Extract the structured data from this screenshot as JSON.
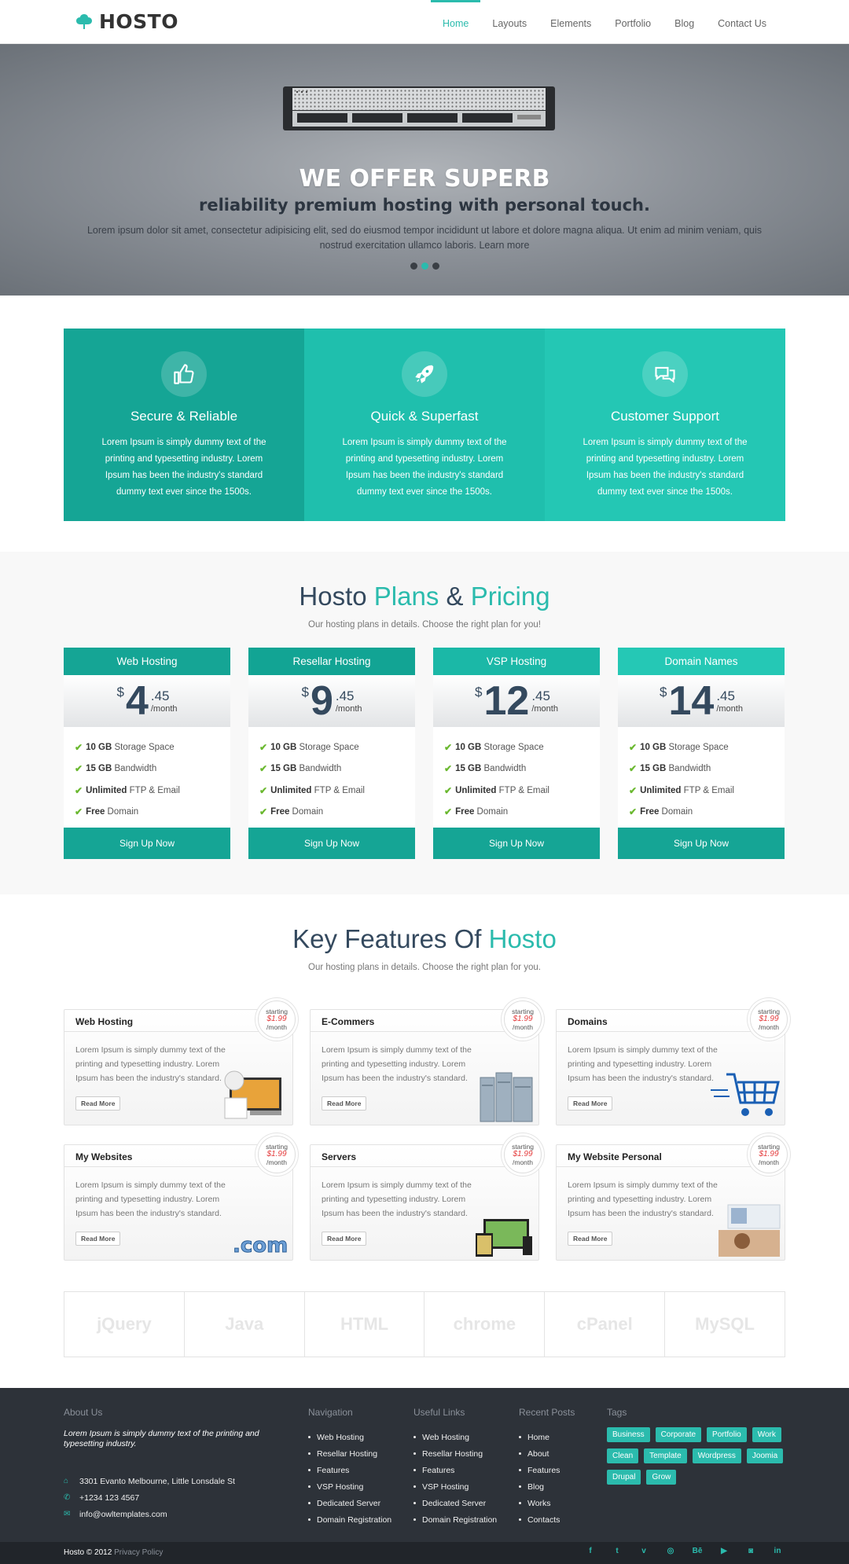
{
  "header": {
    "logo": "HOSTO",
    "nav": [
      "Home",
      "Layouts",
      "Elements",
      "Portfolio",
      "Blog",
      "Contact Us"
    ],
    "active": "Home"
  },
  "hero": {
    "title": "WE OFFER SUPERB",
    "subtitle": "reliability premium hosting with personal touch.",
    "desc": "Lorem ipsum dolor sit amet, consectetur adipisicing elit, sed do eiusmod tempor incididunt ut labore et dolore magna aliqua. Ut enim ad minim veniam, quis nostrud exercitation ullamco laboris. Learn more",
    "slides_total": 3,
    "active_slide": 2
  },
  "features": [
    {
      "icon": "thumbs-up-icon",
      "title": "Secure & Reliable",
      "text": "Lorem Ipsum is simply dummy text of the printing and typesetting industry. Lorem Ipsum has been the industry's standard dummy text ever since the 1500s."
    },
    {
      "icon": "rocket-icon",
      "title": "Quick & Superfast",
      "text": "Lorem Ipsum is simply dummy text of the printing and typesetting industry. Lorem Ipsum has been the industry's standard dummy text ever since the 1500s."
    },
    {
      "icon": "chat-bubbles-icon",
      "title": "Customer Support",
      "text": "Lorem Ipsum is simply dummy text of the printing and typesetting industry. Lorem Ipsum has been the industry's standard dummy text ever since the 1500s."
    }
  ],
  "pricing": {
    "title_a": "Hosto ",
    "title_b": "Plans",
    "title_c": " & ",
    "title_d": "Pricing",
    "subtitle": "Our hosting plans in details. Choose the right plan for you!",
    "plans": [
      {
        "name": "Web Hosting",
        "currency": "$",
        "amount": "4",
        "cents": ".45",
        "per": "/month",
        "button": "Sign Up Now"
      },
      {
        "name": "Resellar Hosting",
        "currency": "$",
        "amount": "9",
        "cents": ".45",
        "per": "/month",
        "button": "Sign Up Now"
      },
      {
        "name": "VSP Hosting",
        "currency": "$",
        "amount": "12",
        "cents": ".45",
        "per": "/month",
        "button": "Sign Up Now"
      },
      {
        "name": "Domain Names",
        "currency": "$",
        "amount": "14",
        "cents": ".45",
        "per": "/month",
        "button": "Sign Up Now"
      }
    ],
    "features": [
      {
        "bold": "10 GB",
        "rest": " Storage Space"
      },
      {
        "bold": "15 GB",
        "rest": " Bandwidth"
      },
      {
        "bold": "Unlimited",
        "rest": " FTP & Email"
      },
      {
        "bold": "Free",
        "rest": " Domain"
      }
    ]
  },
  "key": {
    "title_a": "Key Features Of ",
    "title_b": "Hosto",
    "subtitle": "Our hosting plans in details. Choose the right plan for you.",
    "badge": {
      "starting": "starting",
      "price": "$1.99",
      "per": "/month"
    },
    "read_more": "Read More",
    "text": "Lorem Ipsum is simply dummy text of the printing and typesetting industry. Lorem Ipsum has been the industry's standard.",
    "cards": [
      "Web Hosting",
      "E-Commers",
      "Domains",
      "My Websites",
      "Servers",
      "My Website Personal"
    ]
  },
  "logos": [
    "jQuery",
    "Java",
    "HTML",
    "chrome",
    "cPanel",
    "MySQL"
  ],
  "footer": {
    "about_h": "About Us",
    "about": "Lorem Ipsum is simply dummy text of the printing and typesetting industry.",
    "address": "3301 Evanto Melbourne, Little Lonsdale St",
    "phone": "+1234 123 4567",
    "email": "info@owltemplates.com",
    "nav_h": "Navigation",
    "nav": [
      "Web Hosting",
      "Resellar Hosting",
      "Features",
      "VSP Hosting",
      "Dedicated Server",
      "Domain Registration"
    ],
    "useful_h": "Useful Links",
    "useful": [
      "Web Hosting",
      "Resellar Hosting",
      "Features",
      "VSP Hosting",
      "Dedicated Server",
      "Domain Registration"
    ],
    "recent_h": "Recent Posts",
    "recent": [
      "Home",
      "About",
      "Features",
      "Blog",
      "Works",
      "Contacts"
    ],
    "tags_h": "Tags",
    "tags": [
      "Business",
      "Corporate",
      "Portfolio",
      "Work",
      "Clean",
      "Template",
      "Wordpress",
      "Joomia",
      "Drupal",
      "Grow"
    ]
  },
  "bottom": {
    "copy": "Hosto © 2012 ",
    "privacy": "Privacy Policy",
    "social": [
      {
        "icon": "facebook-icon",
        "g": "f"
      },
      {
        "icon": "twitter-icon",
        "g": "t"
      },
      {
        "icon": "vimeo-icon",
        "g": "v"
      },
      {
        "icon": "dribbble-icon",
        "g": "◎"
      },
      {
        "icon": "behance-icon",
        "g": "Bē"
      },
      {
        "icon": "youtube-icon",
        "g": "▶"
      },
      {
        "icon": "instagram-icon",
        "g": "◙"
      },
      {
        "icon": "linkedin-icon",
        "g": "in"
      }
    ]
  }
}
